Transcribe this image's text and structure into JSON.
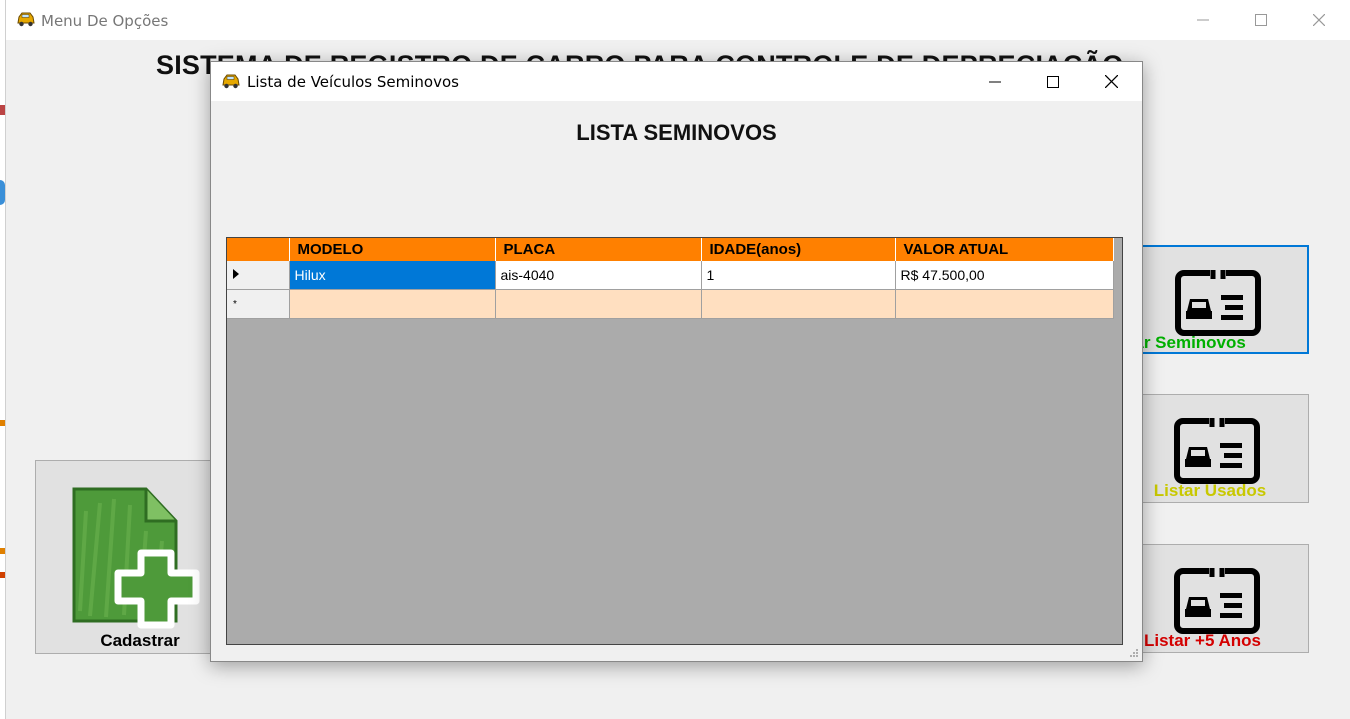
{
  "main_window": {
    "title": "Menu De Opções",
    "heading": "SISTEMA DE REGISTRO DE CARRO PARA CONTROLE DE DEPRECIAÇÃO",
    "buttons": {
      "cadastrar": "Cadastrar",
      "listar_seminovos": "Listar Seminovos",
      "listar_usados": "Listar Usados",
      "listar_5_anos": "Listar +5 Anos"
    },
    "colors": {
      "seminovos": "#00b000",
      "usados": "#c8c800",
      "cinco_anos": "#d40000"
    }
  },
  "child_window": {
    "title": "Lista de Veículos Seminovos",
    "heading": "LISTA SEMINOVOS",
    "grid": {
      "columns": [
        "MODELO",
        "PLACA",
        "IDADE(anos)",
        "VALOR ATUAL"
      ],
      "rows": [
        {
          "modelo": "Hilux",
          "placa": "ais-4040",
          "idade": "1",
          "valor": "R$ 47.500,00"
        }
      ],
      "new_row_marker": "*",
      "header_color": "#ff8000",
      "new_row_color": "#ffdfc0"
    }
  },
  "icons": [
    "car-app-icon",
    "minimize-icon",
    "maximize-icon",
    "close-icon",
    "add-document-icon",
    "vehicle-card-icon",
    "row-pointer-icon",
    "resize-grip-icon"
  ]
}
